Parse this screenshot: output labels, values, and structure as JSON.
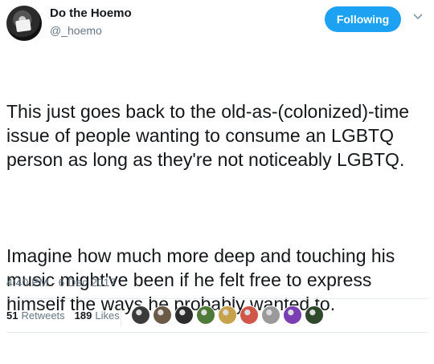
{
  "user": {
    "display_name": "Do the Hoemo",
    "handle": "@_hoemo",
    "follow_label": "Following"
  },
  "tweet": {
    "paragraphs": [
      "This just goes back to the old-as-(colonized)-time issue of people wanting to consume an LGBTQ person as long as they're not noticeably LGBTQ.",
      "Imagine how much more deep and touching his music might've been if he felt free to express himself the ways he probably wanted to."
    ],
    "timestamp": "4:40 PM - 6 Dec 2017"
  },
  "stats": {
    "retweets_count": "51",
    "retweets_label": "Retweets",
    "likes_count": "189",
    "likes_label": "Likes"
  },
  "colors": {
    "accent": "#1da1f2",
    "text": "#14171a",
    "secondary": "#657786",
    "divider": "#e6ecf0"
  },
  "likers": [
    {
      "icon": "liker-avatar-1",
      "color": "#3b3b3b"
    },
    {
      "icon": "liker-avatar-2",
      "color": "#6b5a45"
    },
    {
      "icon": "liker-avatar-3",
      "color": "#2d2d2d"
    },
    {
      "icon": "liker-avatar-4",
      "color": "#4f7a3a"
    },
    {
      "icon": "liker-avatar-5",
      "color": "#c8a24a"
    },
    {
      "icon": "liker-avatar-6",
      "color": "#d0564a"
    },
    {
      "icon": "liker-avatar-7",
      "color": "#9a9a9a"
    },
    {
      "icon": "liker-avatar-8",
      "color": "#7a3fb2"
    },
    {
      "icon": "liker-avatar-9",
      "color": "#2f4a2a"
    }
  ]
}
